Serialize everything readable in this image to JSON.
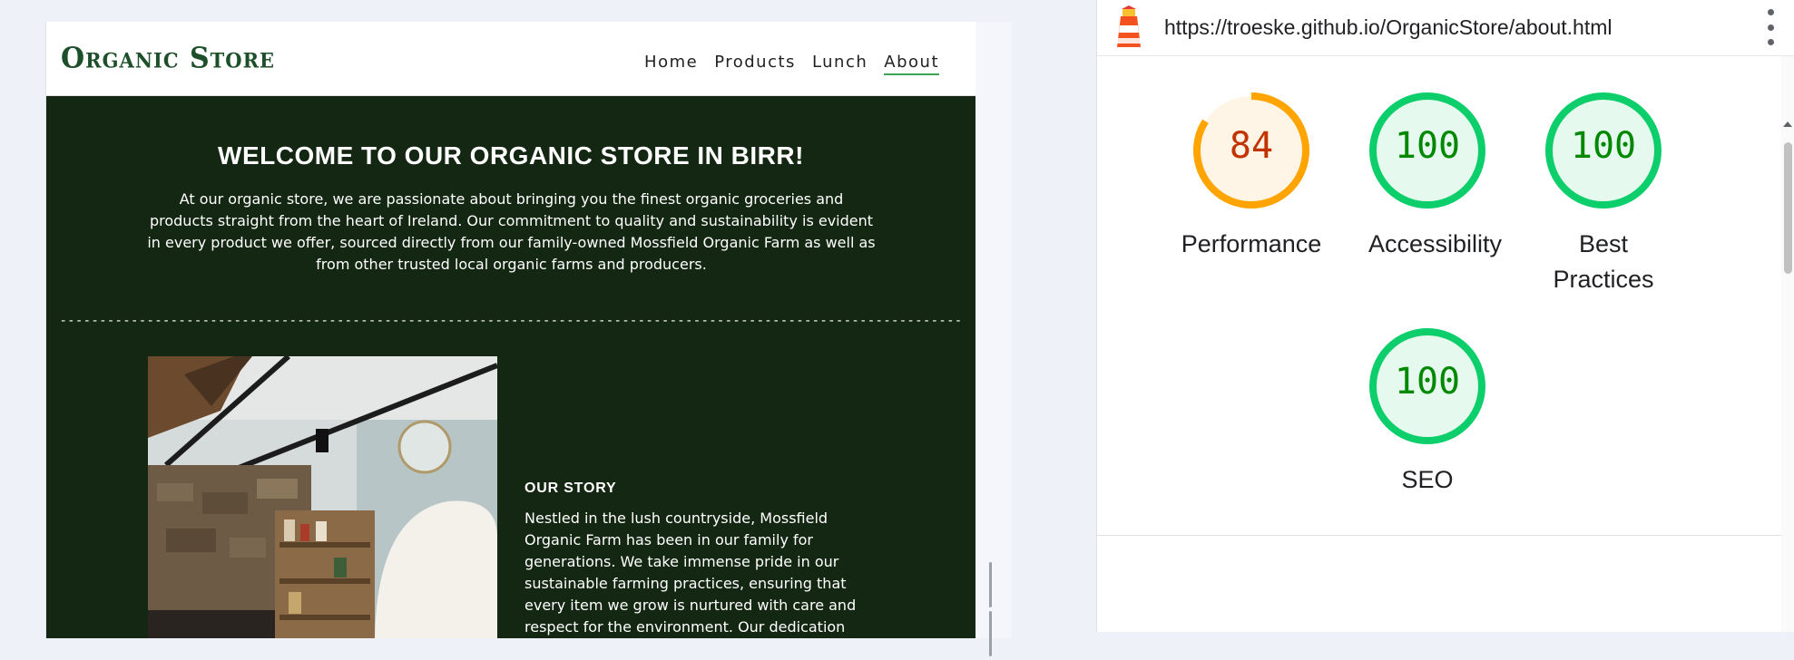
{
  "site": {
    "logo": "Organic Store",
    "nav": [
      {
        "label": "Home",
        "active": false
      },
      {
        "label": "Products",
        "active": false
      },
      {
        "label": "Lunch",
        "active": false
      },
      {
        "label": "About",
        "active": true
      }
    ],
    "welcome_title": "WELCOME TO OUR ORGANIC STORE IN BIRR!",
    "welcome_text": "At our organic store, we are passionate about bringing you the finest organic groceries and products straight from the heart of Ireland. Our commitment to quality and sustainability is evident in every product we offer, sourced directly from our family-owned Mossfield Organic Farm as well as from other trusted local organic farms and producers.",
    "divider": "------------------------------------------------------------------------------------------------------------------",
    "story_heading": "OUR STORY",
    "story_text": "Nestled in the lush countryside, Mossfield Organic Farm has been in our family for generations. We take immense pride in our sustainable farming practices, ensuring that every item we grow is nurtured with care and respect for the environment. Our dedication to",
    "colors": {
      "main_bg": "#132712",
      "logo": "#1d4f2a",
      "active_underline": "#3aa655"
    }
  },
  "lighthouse": {
    "url": "https://troeske.github.io/OrganicStore/about.html",
    "scores": [
      {
        "label": "Performance",
        "value": 84,
        "status": "average"
      },
      {
        "label": "Accessibility",
        "value": 100,
        "status": "pass"
      },
      {
        "label": "Best Practices",
        "value": 100,
        "status": "pass"
      },
      {
        "label": "SEO",
        "value": 100,
        "status": "pass"
      }
    ],
    "colors": {
      "pass": "#0cce6b",
      "pass_text": "#008800",
      "pass_fill": "#e6f9ee",
      "average": "#ffa400",
      "average_text": "#c33300",
      "average_fill": "#fff5e6"
    },
    "icons": {
      "logo": "lighthouse-icon",
      "menu": "more-vertical-icon"
    }
  }
}
